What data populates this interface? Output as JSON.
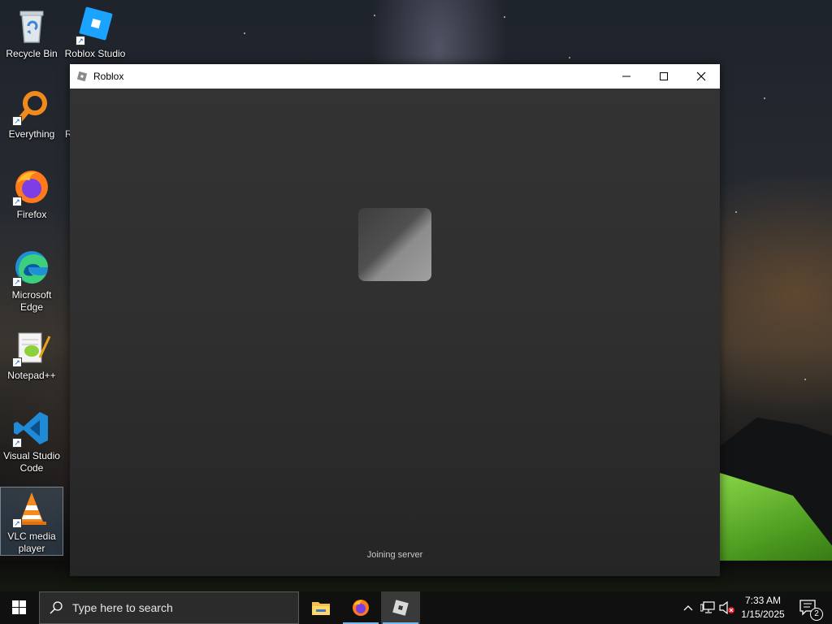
{
  "desktop": {
    "icons": [
      {
        "label": "Recycle Bin",
        "icon": "recycle-bin-icon"
      },
      {
        "label": "Roblox Studio",
        "icon": "roblox-studio-icon"
      },
      {
        "label": "Everything",
        "icon": "everything-search-icon"
      },
      {
        "label": "Firefox",
        "icon": "firefox-icon"
      },
      {
        "label": "Microsoft Edge",
        "icon": "edge-icon"
      },
      {
        "label": "Notepad++",
        "icon": "notepadpp-icon"
      },
      {
        "label": "Visual Studio Code",
        "icon": "vscode-icon"
      },
      {
        "label": "VLC media player",
        "icon": "vlc-icon"
      }
    ],
    "partial_label": "R"
  },
  "window": {
    "title": "Roblox",
    "status": "Joining server"
  },
  "taskbar": {
    "search_placeholder": "Type here to search",
    "apps": [
      "File Explorer",
      "Firefox",
      "Roblox"
    ],
    "active_app": "Roblox",
    "time": "7:33 AM",
    "date": "1/15/2025",
    "notification_count": "2"
  },
  "colors": {
    "accent": "#76b9ed",
    "taskbar": "#101010",
    "window_client": "#2f2f2f"
  }
}
